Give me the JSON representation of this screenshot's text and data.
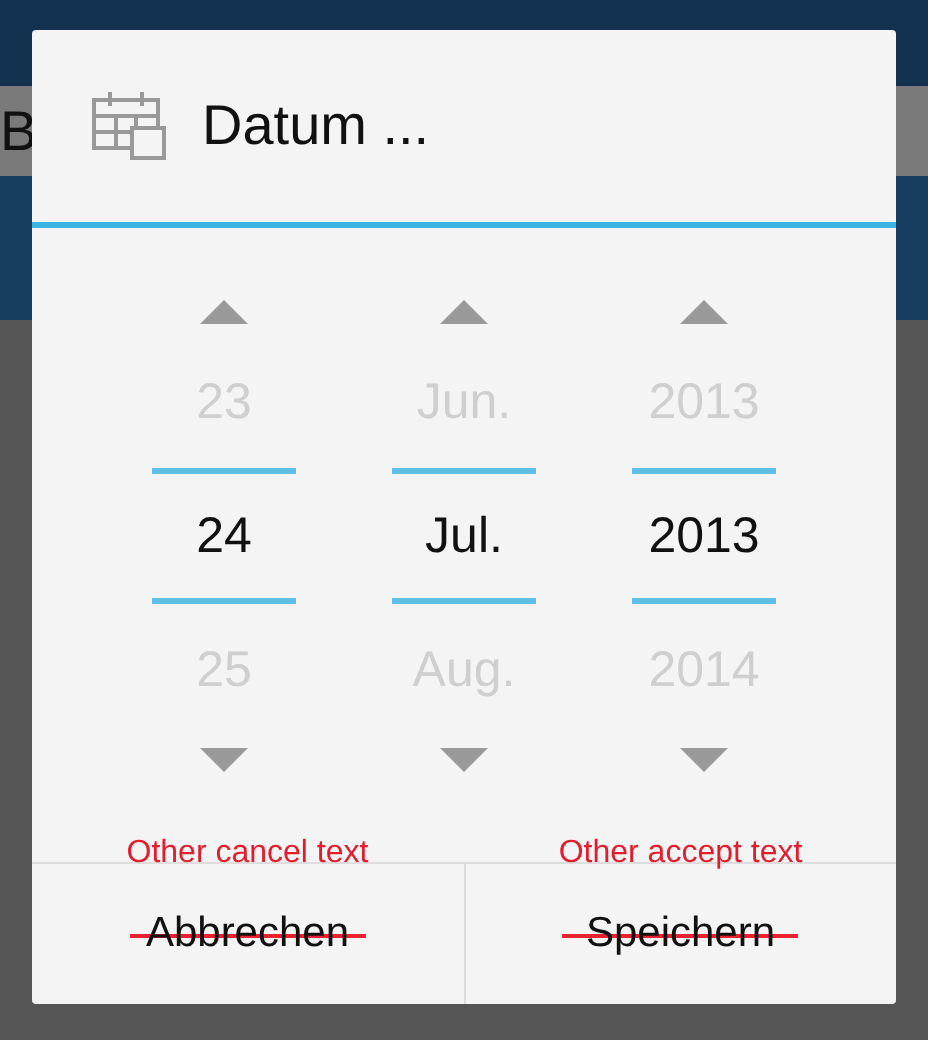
{
  "background": {
    "field_text": "B"
  },
  "dialog": {
    "title": "Datum ...",
    "pickers": [
      {
        "previous": "23",
        "current": "24",
        "next": "25"
      },
      {
        "previous": "Jun.",
        "current": "Jul.",
        "next": "Aug."
      },
      {
        "previous": "2013",
        "current": "2013",
        "next": "2014"
      }
    ],
    "buttons": [
      {
        "label": "Abbrechen",
        "struck": true,
        "note": "Other cancel text"
      },
      {
        "label": "Speichern",
        "struck": true,
        "note": "Other accept text"
      }
    ]
  }
}
